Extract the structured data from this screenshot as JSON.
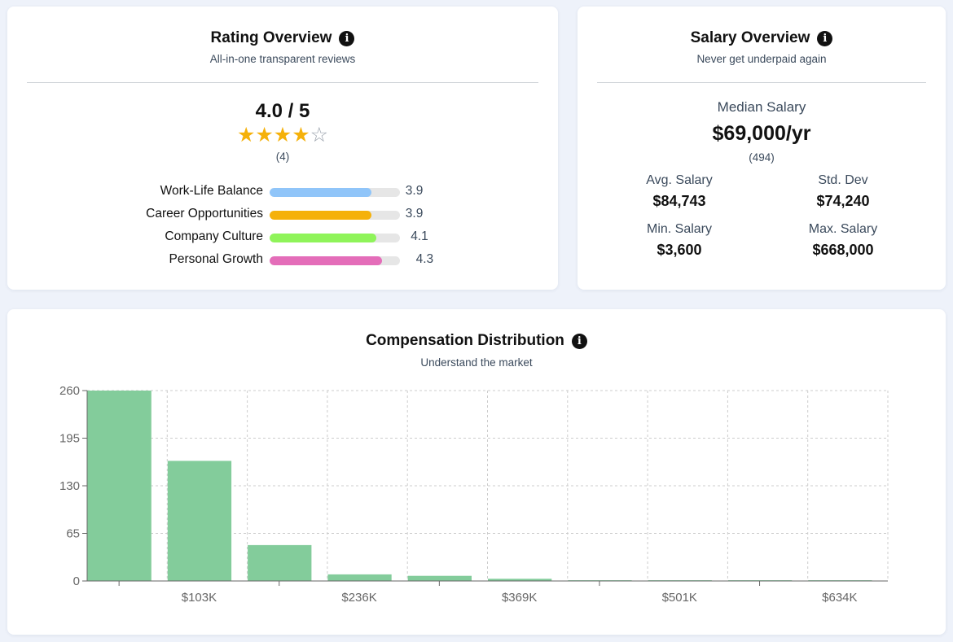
{
  "rating": {
    "title": "Rating Overview",
    "info_icon": "i",
    "subtitle": "All-in-one transparent reviews",
    "score": "4.0 / 5",
    "stars_filled": 4,
    "stars_total": 5,
    "count": "(4)",
    "categories": [
      {
        "label": "Work-Life Balance",
        "value": "3.9",
        "fraction": 0.78,
        "color": "#90c5f9"
      },
      {
        "label": "Career Opportunities",
        "value": "3.9",
        "fraction": 0.78,
        "color": "#f5b10a"
      },
      {
        "label": "Company Culture",
        "value": "4.1",
        "fraction": 0.82,
        "color": "#8ff45a"
      },
      {
        "label": "Personal Growth",
        "value": "4.3",
        "fraction": 0.86,
        "color": "#e46db9"
      }
    ]
  },
  "salary": {
    "title": "Salary Overview",
    "info_icon": "i",
    "subtitle": "Never get underpaid again",
    "median_label": "Median Salary",
    "median_value": "$69,000/yr",
    "count": "(494)",
    "stats": [
      {
        "label": "Avg. Salary",
        "value": "$84,743"
      },
      {
        "label": "Std. Dev",
        "value": "$74,240"
      },
      {
        "label": "Min. Salary",
        "value": "$3,600"
      },
      {
        "label": "Max. Salary",
        "value": "$668,000"
      }
    ]
  },
  "compensation": {
    "title": "Compensation Distribution",
    "info_icon": "i",
    "subtitle": "Understand the market"
  },
  "chart_data": {
    "type": "bar",
    "title": "Compensation Distribution",
    "subtitle": "Understand the market",
    "bar_color": "#83cc9b",
    "ylim": [
      0,
      260
    ],
    "y_ticks": [
      0,
      65,
      130,
      195,
      260
    ],
    "y_tick_labels": [
      "0",
      "65",
      "130",
      "195",
      "260"
    ],
    "x_tick_labels": [
      "$103K",
      "$236K",
      "$369K",
      "$501K",
      "$634K"
    ],
    "grid": true,
    "values": [
      260,
      164,
      49,
      9,
      7,
      3,
      1,
      1,
      1,
      1
    ]
  }
}
